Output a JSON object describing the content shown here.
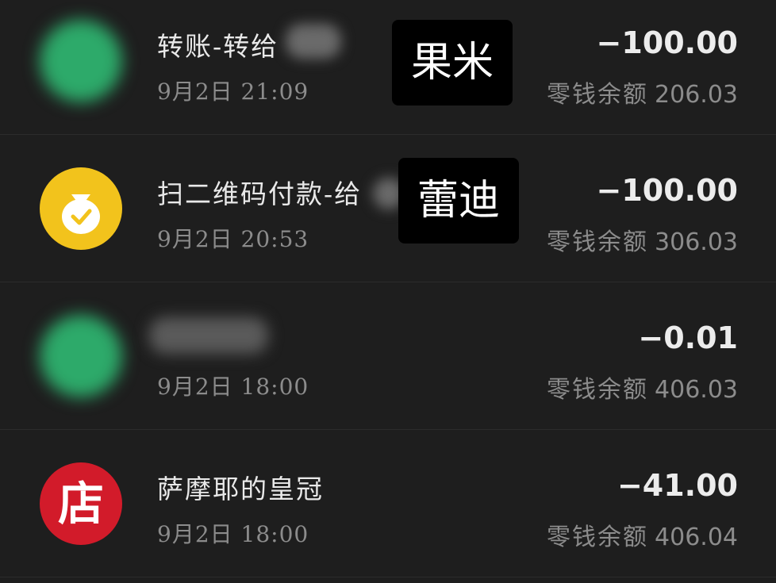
{
  "transactions": [
    {
      "title": "转账-转给",
      "redaction_label": "果米",
      "time": "9月2日 21:09",
      "amount": "−100.00",
      "balance_label": "零钱余额",
      "balance_value": "206.03",
      "icon": "transfer-icon",
      "icon_color": "#2daa6a"
    },
    {
      "title": "扫二维码付款-给",
      "redaction_label": "蕾迪",
      "time": "9月2日 20:53",
      "amount": "−100.00",
      "balance_label": "零钱余额",
      "balance_value": "306.03",
      "icon": "money-bag-icon",
      "icon_color": "#f2c31c"
    },
    {
      "title": "",
      "time": "9月2日 18:00",
      "amount": "−0.01",
      "balance_label": "零钱余额",
      "balance_value": "406.03",
      "icon": "payment-icon",
      "icon_color": "#2daa6a"
    },
    {
      "title": "萨摩耶的皇冠",
      "time": "9月2日 18:00",
      "amount": "−41.00",
      "balance_label": "零钱余额",
      "balance_value": "406.04",
      "icon": "store-icon",
      "icon_char": "店",
      "icon_color": "#d21b2a"
    }
  ]
}
